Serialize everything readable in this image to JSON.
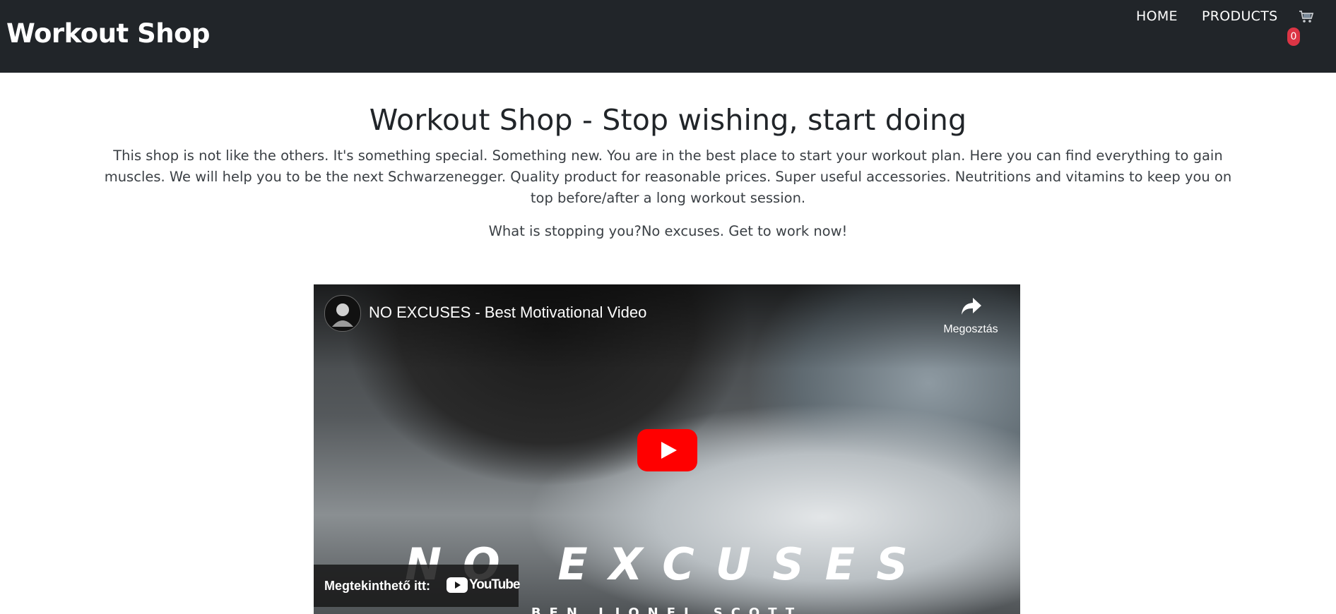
{
  "navbar": {
    "brand": "Workout Shop",
    "links": [
      {
        "label": "HOME"
      },
      {
        "label": "PRODUCTS"
      }
    ],
    "cart": {
      "count": "0",
      "icon": "cart-icon"
    }
  },
  "hero": {
    "title": "Workout Shop - Stop wishing, start doing",
    "description": "This shop is not like the others. It's something special. Something new. You are in the best place to start your workout plan. Here you can find everything to gain muscles. We will help you to be the next Schwarzenegger. Quality product for reasonable prices. Super useful accessories. Neutritions and vitamins to keep you on top before/after a long workout session.",
    "cta": "What is stopping you?No excuses. Get to work now!"
  },
  "video": {
    "title": "NO EXCUSES - Best Motivational Video",
    "share_label": "Megosztás",
    "watch_on_label": "Megtekinthető itt:",
    "youtube_label": "YouTube",
    "overlay_title": "NO EXCUSES",
    "overlay_subtitle": "BEN LIONEL SCOTT"
  },
  "colors": {
    "navbar_bg": "#212529",
    "badge": "#dc3545",
    "play_button": "#ff0000"
  }
}
